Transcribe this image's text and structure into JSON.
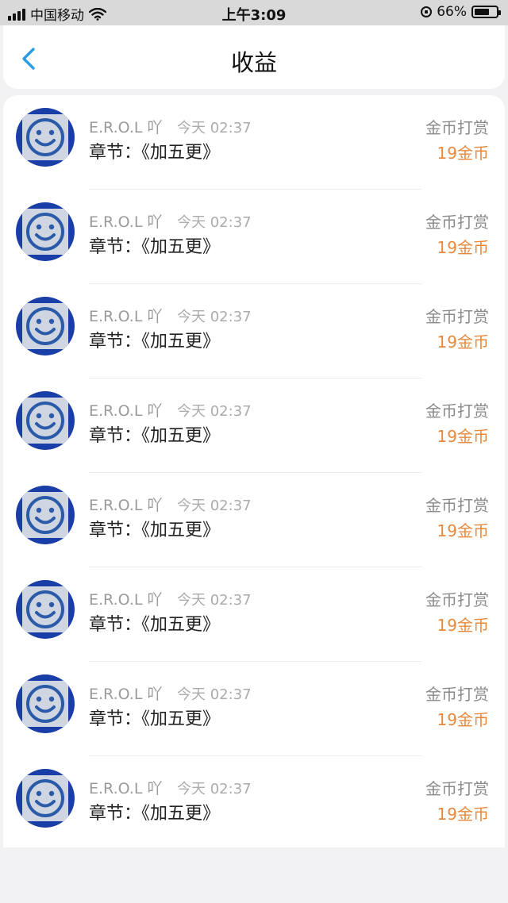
{
  "status_bar": {
    "carrier": "中国移动",
    "time": "上午3:09",
    "battery_percent": "66%"
  },
  "header": {
    "title": "收益",
    "back_icon": "chevron-left-icon"
  },
  "colors": {
    "accent": "#2b9be6",
    "amount": "#e8883c",
    "avatar_ring": "#1a3ea8"
  },
  "records": [
    {
      "user": "E.R.O.L 吖",
      "time": "今天 02:37",
      "chapter": "章节：《加五更》",
      "type": "金币打赏",
      "amount": "19金币"
    },
    {
      "user": "E.R.O.L 吖",
      "time": "今天 02:37",
      "chapter": "章节：《加五更》",
      "type": "金币打赏",
      "amount": "19金币"
    },
    {
      "user": "E.R.O.L 吖",
      "time": "今天 02:37",
      "chapter": "章节：《加五更》",
      "type": "金币打赏",
      "amount": "19金币"
    },
    {
      "user": "E.R.O.L 吖",
      "time": "今天 02:37",
      "chapter": "章节：《加五更》",
      "type": "金币打赏",
      "amount": "19金币"
    },
    {
      "user": "E.R.O.L 吖",
      "time": "今天 02:37",
      "chapter": "章节：《加五更》",
      "type": "金币打赏",
      "amount": "19金币"
    },
    {
      "user": "E.R.O.L 吖",
      "time": "今天 02:37",
      "chapter": "章节：《加五更》",
      "type": "金币打赏",
      "amount": "19金币"
    },
    {
      "user": "E.R.O.L 吖",
      "time": "今天 02:37",
      "chapter": "章节：《加五更》",
      "type": "金币打赏",
      "amount": "19金币"
    },
    {
      "user": "E.R.O.L 吖",
      "time": "今天 02:37",
      "chapter": "章节：《加五更》",
      "type": "金币打赏",
      "amount": "19金币"
    }
  ]
}
